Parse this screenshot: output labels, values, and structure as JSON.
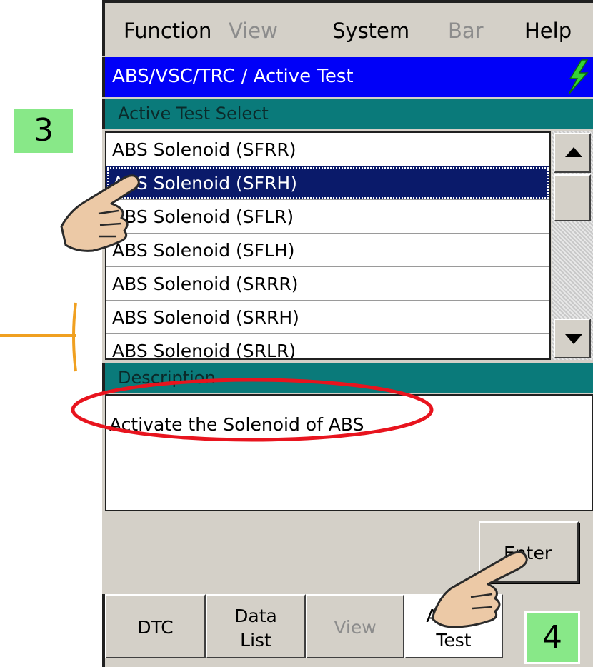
{
  "menu": {
    "items": [
      {
        "label": "Function",
        "enabled": true
      },
      {
        "label": "View",
        "enabled": false
      },
      {
        "label": "System",
        "enabled": true
      },
      {
        "label": "Bar",
        "enabled": false
      },
      {
        "label": "Help",
        "enabled": true
      }
    ]
  },
  "title": "ABS/VSC/TRC / Active Test",
  "select_header": "Active Test Select",
  "tests": [
    {
      "label": "ABS Solenoid (SFRR)",
      "selected": false
    },
    {
      "label": "ABS Solenoid (SFRH)",
      "selected": true
    },
    {
      "label": "ABS Solenoid (SFLR)",
      "selected": false
    },
    {
      "label": "ABS Solenoid (SFLH)",
      "selected": false
    },
    {
      "label": "ABS Solenoid (SRRR)",
      "selected": false
    },
    {
      "label": "ABS Solenoid (SRRH)",
      "selected": false
    },
    {
      "label": "ABS Solenoid (SRLR)",
      "selected": false
    }
  ],
  "description_header": "Description",
  "description_text": "Activate the Solenoid of ABS",
  "enter_label": "Enter",
  "tabs": [
    {
      "line1": "DTC",
      "line2": "",
      "enabled": true,
      "active": false
    },
    {
      "line1": "Data",
      "line2": "List",
      "enabled": true,
      "active": false
    },
    {
      "line1": "View",
      "line2": "",
      "enabled": false,
      "active": false
    },
    {
      "line1": "Active",
      "line2": "Test",
      "enabled": true,
      "active": true
    }
  ],
  "annotations": {
    "step_3": "3",
    "step_4": "4"
  },
  "colors": {
    "title_bar": "#0000f8",
    "section_header": "#0a7a7a",
    "selected_row": "#0a1a6a",
    "badge": "#88e888",
    "ellipse": "#e8141e",
    "arrow": "#f0a020"
  }
}
